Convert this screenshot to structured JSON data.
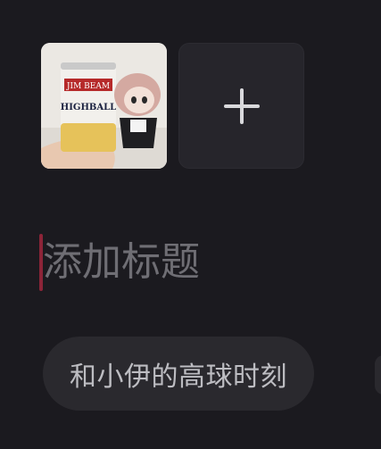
{
  "media": {
    "photo_alt": "JIM BEAM HIGHBALL can with plush doll",
    "can_brand": "JIM BEAM",
    "can_label": "HIGHBALL"
  },
  "title_field": {
    "placeholder": "添加标题",
    "value": ""
  },
  "topic_chips": [
    {
      "label": "和小伊的高球时刻"
    }
  ],
  "colors": {
    "background": "#1b1a1f",
    "tile": "#26252b",
    "chip": "#2a292e",
    "cursor": "#8c2438",
    "placeholder": "#6f6e74"
  }
}
